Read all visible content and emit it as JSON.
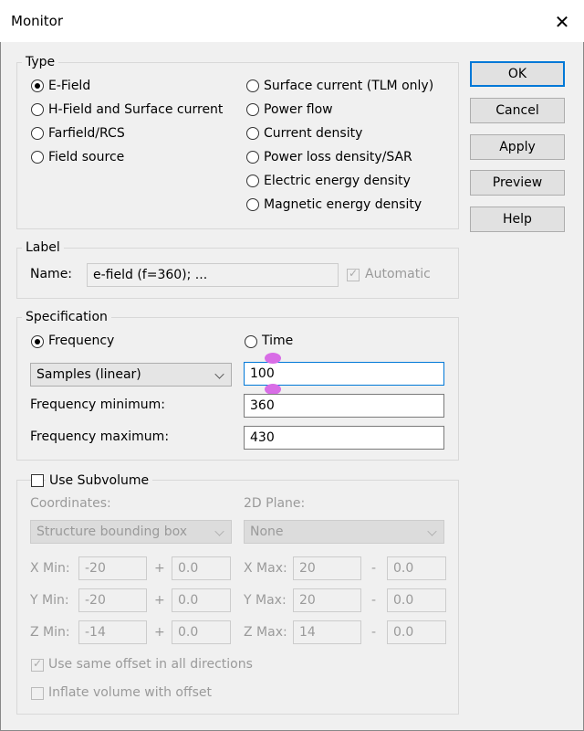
{
  "window": {
    "title": "Monitor",
    "close": "✕"
  },
  "buttons": {
    "ok": "OK",
    "cancel": "Cancel",
    "apply": "Apply",
    "preview": "Preview",
    "help": "Help"
  },
  "type_group": {
    "legend": "Type",
    "left": [
      "E-Field",
      "H-Field and Surface current",
      "Farfield/RCS",
      "Field source"
    ],
    "right": [
      "Surface current (TLM only)",
      "Power flow",
      "Current density",
      "Power loss density/SAR",
      "Electric energy density",
      "Magnetic energy density"
    ],
    "selected": "E-Field"
  },
  "label_group": {
    "legend": "Label",
    "name_label": "Name:",
    "name_value": "e-field (f=360); ...",
    "automatic": "Automatic",
    "automatic_checked": true
  },
  "spec_group": {
    "legend": "Specification",
    "frequency": "Frequency",
    "time": "Time",
    "selected": "Frequency",
    "samples_select": "Samples (linear)",
    "samples_value": "100",
    "fmin_label": "Frequency minimum:",
    "fmin_value": "360",
    "fmax_label": "Frequency maximum:",
    "fmax_value": "430"
  },
  "subvolume": {
    "use_label": "Use Subvolume",
    "coordinates_label": "Coordinates:",
    "coordinates_value": "Structure bounding box",
    "plane_label": "2D Plane:",
    "plane_value": "None",
    "xmin_label": "X Min:",
    "xmin": "-20",
    "xmin_off": "0.0",
    "ymin_label": "Y Min:",
    "ymin": "-20",
    "ymin_off": "0.0",
    "zmin_label": "Z Min:",
    "zmin": "-14",
    "zmin_off": "0.0",
    "xmax_label": "X Max:",
    "xmax": "20",
    "xmax_off": "0.0",
    "ymax_label": "Y Max:",
    "ymax": "20",
    "ymax_off": "0.0",
    "zmax_label": "Z Max:",
    "zmax": "14",
    "zmax_off": "0.0",
    "plus": "+",
    "minus": "-",
    "same_offset": "Use same offset in all directions",
    "inflate": "Inflate volume with offset"
  }
}
